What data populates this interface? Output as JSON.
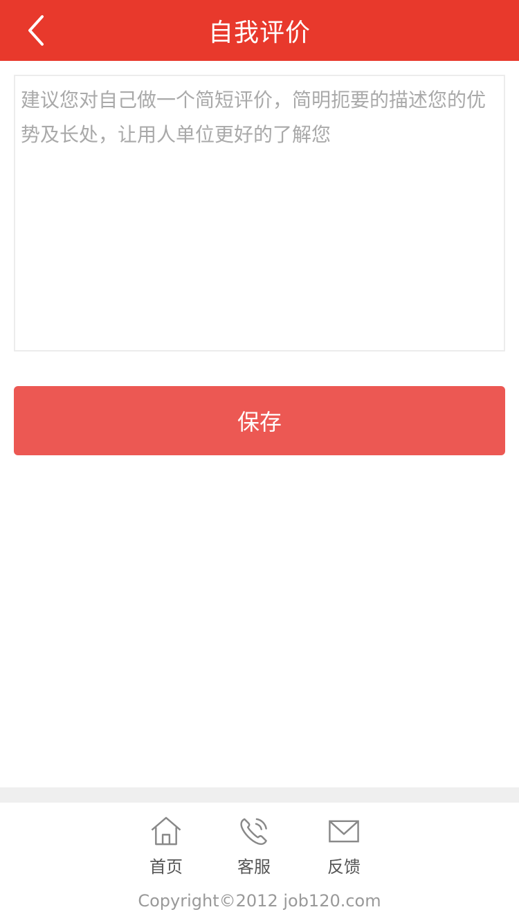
{
  "header": {
    "title": "自我评价",
    "back_icon": "chevron-left-icon",
    "background": "#e8392c"
  },
  "evaluation": {
    "placeholder": "建议您对自己做一个简短评价，简明扼要的描述您的优势及长处，让用人单位更好的了解您",
    "value": ""
  },
  "actions": {
    "save_label": "保存",
    "save_color": "#ec5853"
  },
  "footer": {
    "nav": [
      {
        "label": "首页",
        "icon": "home-icon"
      },
      {
        "label": "客服",
        "icon": "phone-icon"
      },
      {
        "label": "反馈",
        "icon": "mail-icon"
      }
    ],
    "copyright": "Copyright©2012  job120.com"
  }
}
